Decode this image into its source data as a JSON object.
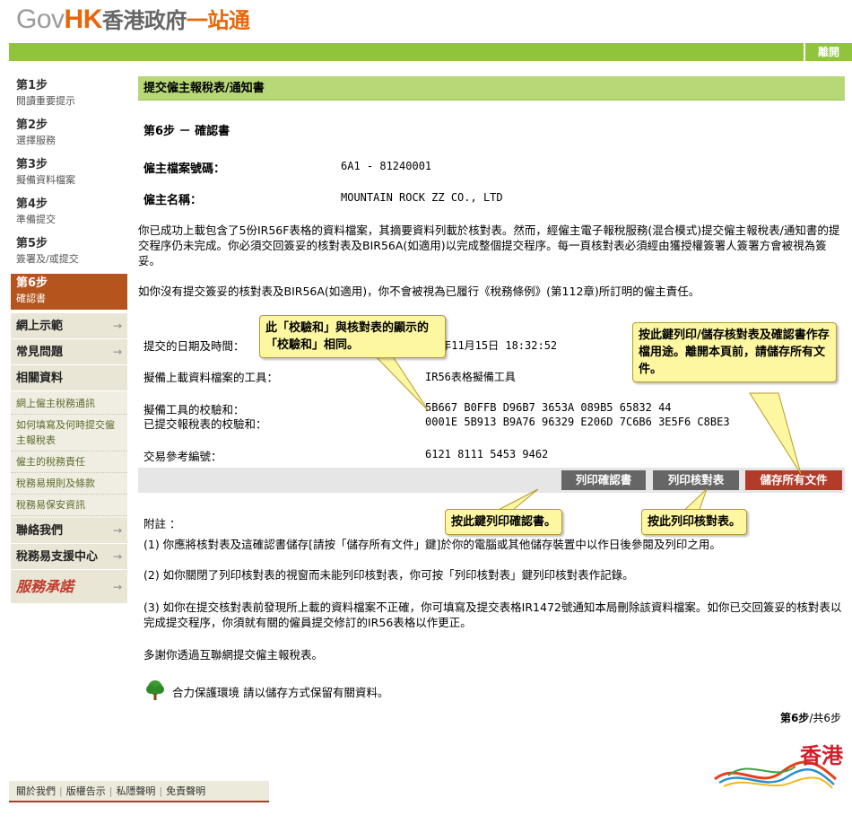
{
  "header": {
    "logo_gov": "Gov",
    "logo_hk": "HK",
    "logo_zh": "香港政府",
    "logo_zh2": "一站通",
    "exit_label": "離開"
  },
  "sidebar": {
    "steps": [
      {
        "title": "第1步",
        "sub": "閱讀重要提示"
      },
      {
        "title": "第2步",
        "sub": "選擇服務"
      },
      {
        "title": "第3步",
        "sub": "擬備資料檔案"
      },
      {
        "title": "第4步",
        "sub": "準備提交"
      },
      {
        "title": "第5步",
        "sub": "簽署及/或提交"
      },
      {
        "title": "第6步",
        "sub": "確認書"
      }
    ],
    "nav": {
      "demo": "網上示範",
      "faq": "常見問題",
      "related": "相關資料",
      "links": [
        "網上僱主稅務通訊",
        "如何填寫及何時提交僱主報稅表",
        "僱主的稅務責任",
        "稅務易規則及條款",
        "稅務易保安資訊"
      ],
      "contact": "聯絡我們",
      "support": "稅務易支援中心",
      "service": "服務承諾"
    }
  },
  "main": {
    "heading": "提交僱主報稅表/通知書",
    "step_title": "第6步 － 確認書",
    "file_no_label": "僱主檔案號碼：",
    "file_no": "6A1 - 81240001",
    "name_label": "僱主名稱：",
    "name": "MOUNTAIN ROCK ZZ CO., LTD",
    "para1": "你已成功上載包含了5份IR56F表格的資料檔案，其摘要資料列載於核對表。然而，經僱主電子報稅服務(混合模式)提交僱主報稅表/通知書的提交程序仍未完成。你必須交回簽妥的核對表及BIR56A(如適用)以完成整個提交程序。每一頁核對表必須經由獲授權簽署人簽署方會被視為簽妥。",
    "para2": "如你沒有提交簽妥的核對表及BIR56A(如適用)，你不會被視為已履行《稅務條例》(第112章)所訂明的僱主責任。",
    "date_label": "提交的日期及時間：",
    "date_value": "3年11月15日 18:32:52",
    "tool_label": "擬備上載資料檔案的工具：",
    "tool_value": "IR56表格擬備工具",
    "checksum_tool_label": "擬備工具的校驗和：",
    "checksum_tool_value": "5B667 B0FFB D96B7 3653A 089B5 65832 44",
    "checksum_submit_label": "已提交報稅表的校驗和：",
    "checksum_submit_value": "0001E 5B913 B9A76 96329 E206D 7C6B6 3E5F6 C8BE3",
    "ref_label": "交易參考編號：",
    "ref_value": "6121 8111 5453 9462",
    "btn_print_ack": "列印確認書",
    "btn_print_list": "列印核對表",
    "btn_save_all": "儲存所有文件",
    "notes_label": "附註 ：",
    "note1": "(1) 你應將核對表及這確認書儲存[請按「儲存所有文件」鍵]於你的電腦或其他儲存裝置中以作日後參閱及列印之用。",
    "note2": "(2) 如你關閉了列印核對表的視窗而未能列印核對表，你可按「列印核對表」鍵列印核對表作記錄。",
    "note3": "(3) 如你在提交核對表前發現所上載的資料檔案不正確，你可填寫及提交表格IR1472號通知本局刪除該資料檔案。如你已交回簽妥的核對表以完成提交程序，你須就有關的僱員提交修訂的IR56表格以作更正。",
    "thanks": "多謝你透過互聯網提交僱主報稅表。",
    "green_text": "合力保護環境 請以儲存方式保留有關資料。",
    "page_current": "第6步",
    "page_total": "/共6步"
  },
  "callouts": {
    "checksum": "此「校驗和」與核對表的顯示的「校驗和」相同。",
    "save": "按此鍵列印/儲存核對表及確認書作存檔用途。離開本頁前，請儲存所有文件。",
    "print_ack": "按此鍵列印確認書。",
    "print_list": "按此列印核對表。"
  },
  "footer": {
    "about": "關於我們",
    "copyright": "版權告示",
    "privacy": "私隱聲明",
    "disclaimer": "免責聲明"
  },
  "brand": {
    "text": "香港"
  },
  "colors": {
    "green": "#8fc43c",
    "heading": "#b8d878",
    "active_step": "#b5541c",
    "btn_gray": "#666666",
    "btn_red": "#b23b2a",
    "callout": "#fdf7a1"
  }
}
